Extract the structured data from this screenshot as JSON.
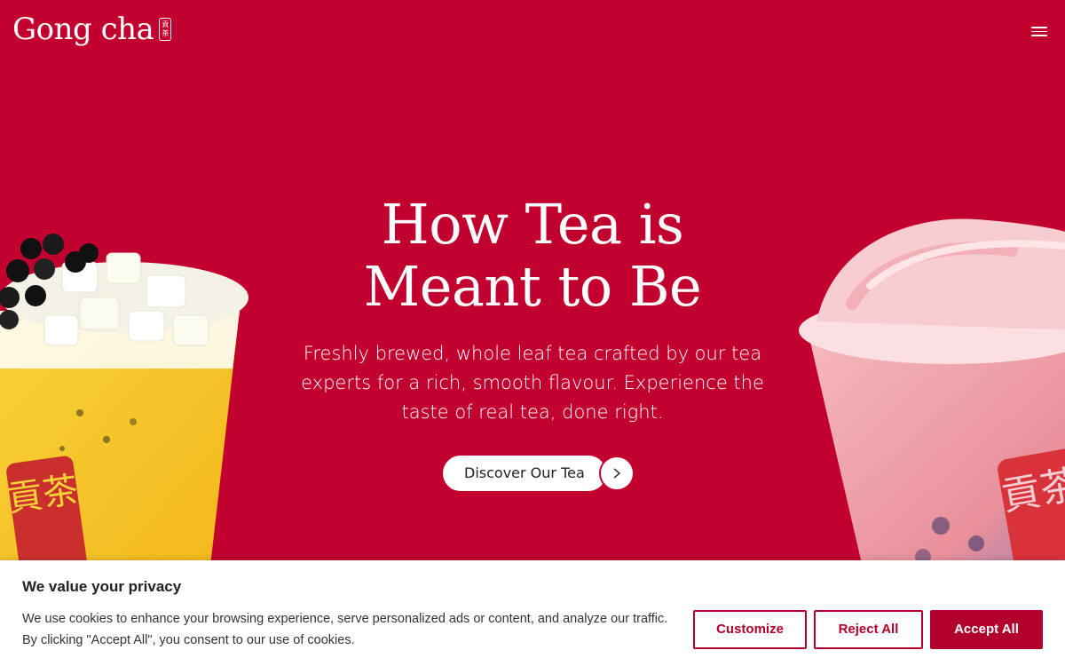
{
  "header": {
    "logo_text": "Gong cha",
    "logo_seal": "貢茶",
    "menu_icon": "hamburger-menu-icon"
  },
  "hero": {
    "title_line1": "How Tea is",
    "title_line2": "Meant to Be",
    "subtitle": "Freshly brewed, whole leaf tea crafted by our tea experts for a rich, smooth flavour. Experience the taste of real tea, done right.",
    "cta_label": "Discover Our Tea",
    "cta_icon": "chevron-right-icon",
    "cup_left_label": "貢茶",
    "cup_right_label": "貢茶"
  },
  "cookie": {
    "title": "We value your privacy",
    "text": "We use cookies to enhance your browsing experience, serve personalized ads or content, and analyze our traffic. By clicking \"Accept All\", you consent to our use of cookies.",
    "customize_label": "Customize",
    "reject_label": "Reject All",
    "accept_label": "Accept All"
  },
  "colors": {
    "brand_red": "#c2002f",
    "button_red": "#b1002b",
    "white": "#ffffff"
  }
}
